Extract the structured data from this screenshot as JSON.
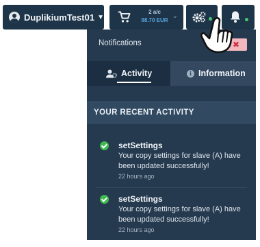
{
  "topbar": {
    "username": "DuplikiumTest01",
    "cart": {
      "count": "2 a/c",
      "amount": "98.70 EUR"
    }
  },
  "notifications": {
    "title": "Notifications",
    "close_symbol": "✖",
    "tabs": [
      {
        "label": "Activity",
        "active": true
      },
      {
        "label": "Information",
        "active": false
      }
    ],
    "section_title": "YOUR RECENT ACTIVITY",
    "items": [
      {
        "title": "setSettings",
        "message": "Your copy settings for slave (A) have been updated successfully!",
        "time": "22 hours ago"
      },
      {
        "title": "setSettings",
        "message": "Your copy settings for slave (A) have been updated successfully!",
        "time": "22 hours ago"
      }
    ]
  },
  "colors": {
    "topbar_bg": "#1e3448",
    "panel_bg": "#263a4f",
    "status_dot": "#48c774",
    "accent_blue": "#56a8e4",
    "close_bg": "#f3b8bd"
  }
}
